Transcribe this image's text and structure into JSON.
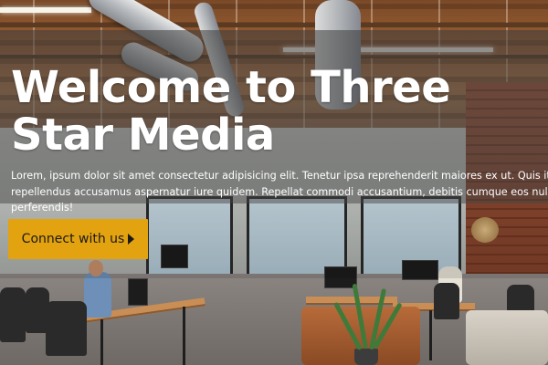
{
  "hero": {
    "title": "Welcome to Three Star Media",
    "body_lines": [
      "Lorem, ipsum dolor sit amet consectetur adipisicing elit. Tenetur ipsa reprehenderit maiores ex ut. Quis itaque",
      "repellendus accusamus aspernatur iure quidem. Repellat commodi accusantium, debitis cumque eos nulla nam",
      "perferendis!"
    ],
    "cta_label": "Connect with us",
    "cta_icon": "play-triangle-icon"
  },
  "colors": {
    "cta_background": "#e3a20f",
    "title_text": "#ffffff",
    "overlay": "#3c3c3c"
  },
  "background": {
    "description_icon": "office-photo"
  }
}
